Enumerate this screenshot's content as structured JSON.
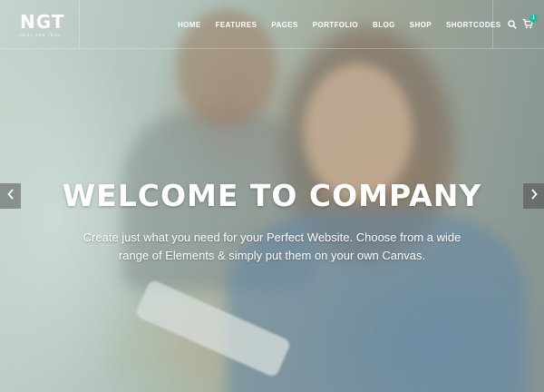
{
  "logo": {
    "main": "NGT",
    "sub": "NEXT GEN TECH"
  },
  "nav": {
    "items": [
      {
        "label": "HOME"
      },
      {
        "label": "FEATURES"
      },
      {
        "label": "PAGES"
      },
      {
        "label": "PORTFOLIO"
      },
      {
        "label": "BLOG"
      },
      {
        "label": "SHOP"
      },
      {
        "label": "SHORTCODES"
      }
    ]
  },
  "icons": {
    "search": "search-icon",
    "cart": "cart-icon",
    "prev": "chevron-left-icon",
    "next": "chevron-right-icon"
  },
  "cart": {
    "count": "1"
  },
  "hero": {
    "title": "WELCOME TO COMPANY",
    "subtitle": "Create just what you need for your Perfect Website. Choose from a wide range of Elements & simply put them on your own Canvas."
  },
  "colors": {
    "accent": "#1abc9c",
    "text": "#ffffff"
  }
}
